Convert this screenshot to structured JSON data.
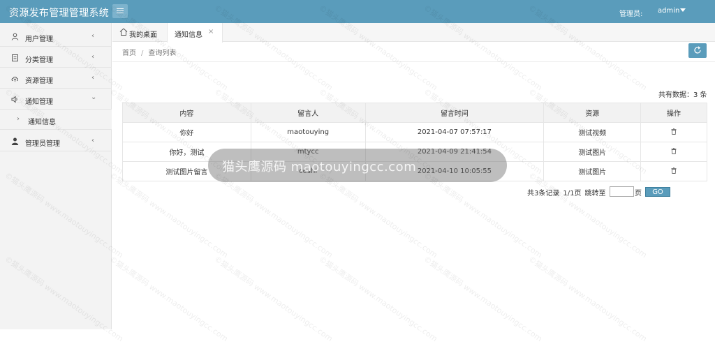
{
  "header": {
    "app_title": "资源发布管理管理系统",
    "admin_label": "管理员:",
    "admin_name": "admin"
  },
  "sidebar": {
    "items": [
      {
        "label": "用户管理",
        "icon": "user-icon"
      },
      {
        "label": "分类管理",
        "icon": "clipboard-icon"
      },
      {
        "label": "资源管理",
        "icon": "cloud-upload-icon"
      },
      {
        "label": "通知管理",
        "icon": "volume-icon"
      },
      {
        "label": "管理员管理",
        "icon": "person-icon"
      }
    ],
    "sub_item": {
      "label": "通知信息"
    }
  },
  "tabs": {
    "home": "我的桌面",
    "active": "通知信息"
  },
  "breadcrumb": {
    "home": "首页",
    "separator": "/",
    "current": "查询列表"
  },
  "summary": {
    "total": "共有数据：3 条"
  },
  "table": {
    "headers": [
      "内容",
      "留言人",
      "留言时间",
      "资源",
      "操作"
    ],
    "rows": [
      {
        "content": "你好",
        "user": "maotouying",
        "time": "2021-04-07 07:57:17",
        "resource": "测试视频"
      },
      {
        "content": "你好，测试",
        "user": "mtycc",
        "time": "2021-04-09 21:41:54",
        "resource": "测试图片"
      },
      {
        "content": "测试图片留言",
        "user": "ceshi",
        "time": "2021-04-10 10:05:55",
        "resource": "测试图片"
      }
    ]
  },
  "pager": {
    "records": "共3条记录",
    "pages": "1/1页",
    "jump_label": "跳转至",
    "page_unit": "页",
    "go": "GO"
  },
  "watermark": {
    "overlay_text": "猫头鹰源码 maotouyingcc.com",
    "tile_text": "©猫头鹰源码 www.maotouyingcc.com"
  },
  "colors": {
    "header": "#5a9cbb",
    "accent": "#5a9cbb"
  }
}
